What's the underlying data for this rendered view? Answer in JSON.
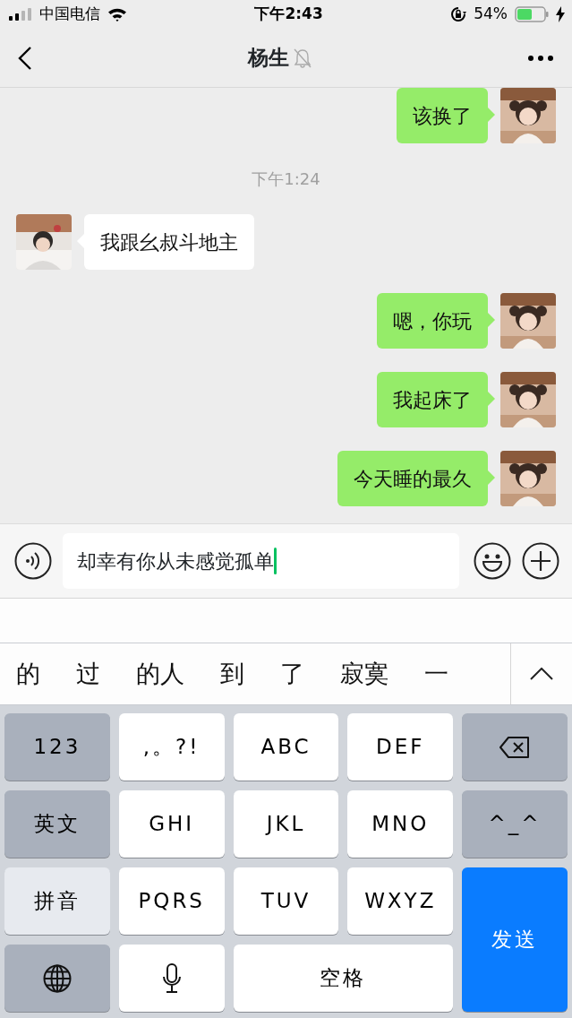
{
  "status_bar": {
    "carrier": "中国电信",
    "time": "下午2:43",
    "battery": "54%"
  },
  "nav": {
    "title": "杨生",
    "muted": true
  },
  "messages": [
    {
      "kind": "message",
      "outgoing": true,
      "text": "该换了"
    },
    {
      "kind": "time",
      "text": "下午1:24"
    },
    {
      "kind": "message",
      "outgoing": false,
      "text": "我跟幺叔斗地主"
    },
    {
      "kind": "message",
      "outgoing": true,
      "text": "嗯，你玩"
    },
    {
      "kind": "message",
      "outgoing": true,
      "text": "我起床了"
    },
    {
      "kind": "message",
      "outgoing": true,
      "text": "今天睡的最久"
    }
  ],
  "input": {
    "value": "却幸有你从未感觉孤单"
  },
  "candidates": [
    "的",
    "过",
    "的人",
    "到",
    "了",
    "寂寞",
    "一"
  ],
  "keys": [
    {
      "kind": "function",
      "label": "123"
    },
    {
      "kind": "letter",
      "label": ",。?!"
    },
    {
      "kind": "letter",
      "label": "ABC"
    },
    {
      "kind": "letter",
      "label": "DEF"
    },
    {
      "kind": "delete"
    },
    {
      "kind": "function",
      "label": "英文"
    },
    {
      "kind": "letter",
      "label": "GHI"
    },
    {
      "kind": "letter",
      "label": "JKL"
    },
    {
      "kind": "letter",
      "label": "MNO"
    },
    {
      "kind": "function",
      "label": "^_^"
    },
    {
      "kind": "function",
      "label": "拼音",
      "selected": true
    },
    {
      "kind": "letter",
      "label": "PQRS"
    },
    {
      "kind": "letter",
      "label": "TUV"
    },
    {
      "kind": "letter",
      "label": "WXYZ"
    },
    {
      "kind": "send",
      "label": "发送"
    },
    {
      "kind": "globe"
    },
    {
      "kind": "mic"
    },
    {
      "kind": "space",
      "label": "空格"
    }
  ]
}
